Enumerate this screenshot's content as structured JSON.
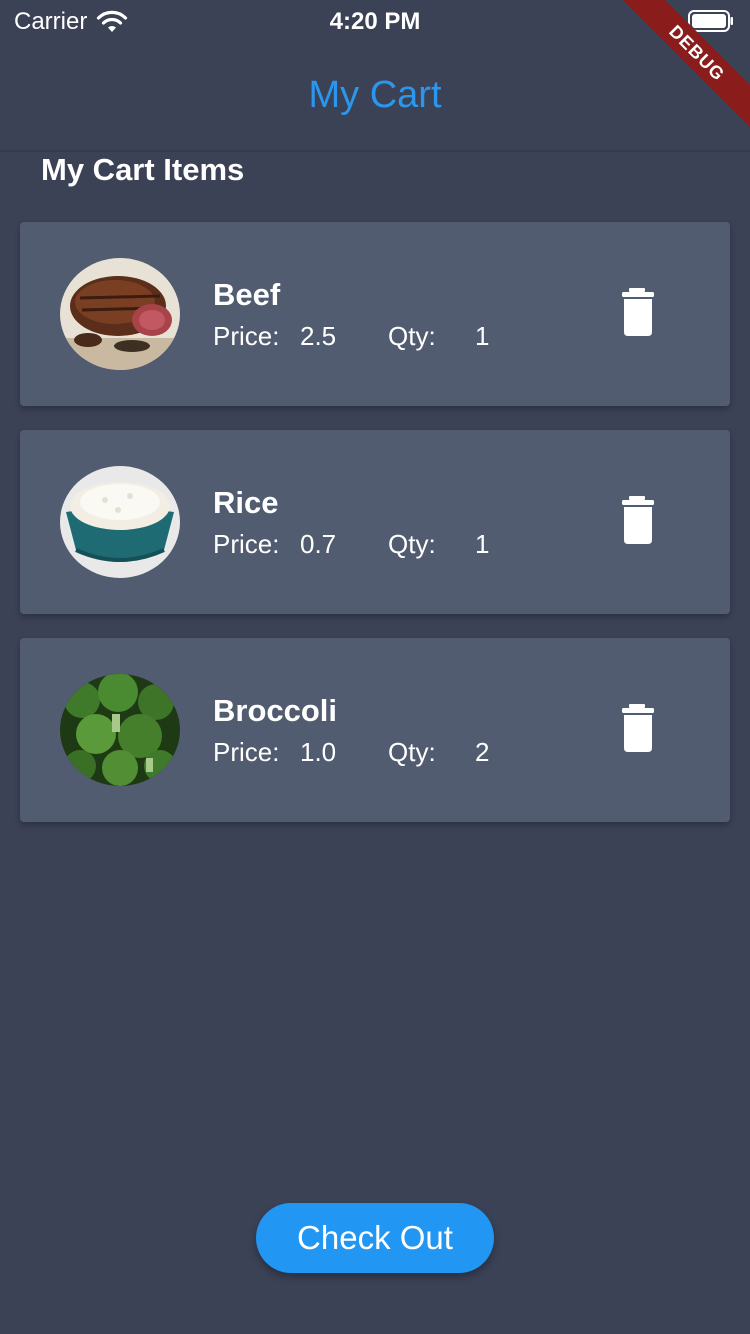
{
  "status_bar": {
    "carrier": "Carrier",
    "time": "4:20 PM"
  },
  "debug_banner": "DEBUG",
  "app_bar": {
    "title": "My Cart"
  },
  "section_title": "My Cart Items",
  "cart_items": [
    {
      "name": "Beef",
      "price_label": "Price:",
      "price": "2.5",
      "qty_label": "Qty:",
      "qty": "1",
      "image": "roast-beef-photo"
    },
    {
      "name": "Rice",
      "price_label": "Price:",
      "price": "0.7",
      "qty_label": "Qty:",
      "qty": "1",
      "image": "rice-bowl-photo"
    },
    {
      "name": "Broccoli",
      "price_label": "Price:",
      "price": "1.0",
      "qty_label": "Qty:",
      "qty": "2",
      "image": "broccoli-photo"
    }
  ],
  "checkout_label": "Check Out",
  "icons": {
    "delete": "trash-icon",
    "wifi": "wifi-icon",
    "battery": "battery-icon"
  },
  "colors": {
    "background": "#3b4256",
    "card": "#525c70",
    "accent": "#2196f3",
    "title": "#2a96ee",
    "debug": "#8b1c1c"
  }
}
